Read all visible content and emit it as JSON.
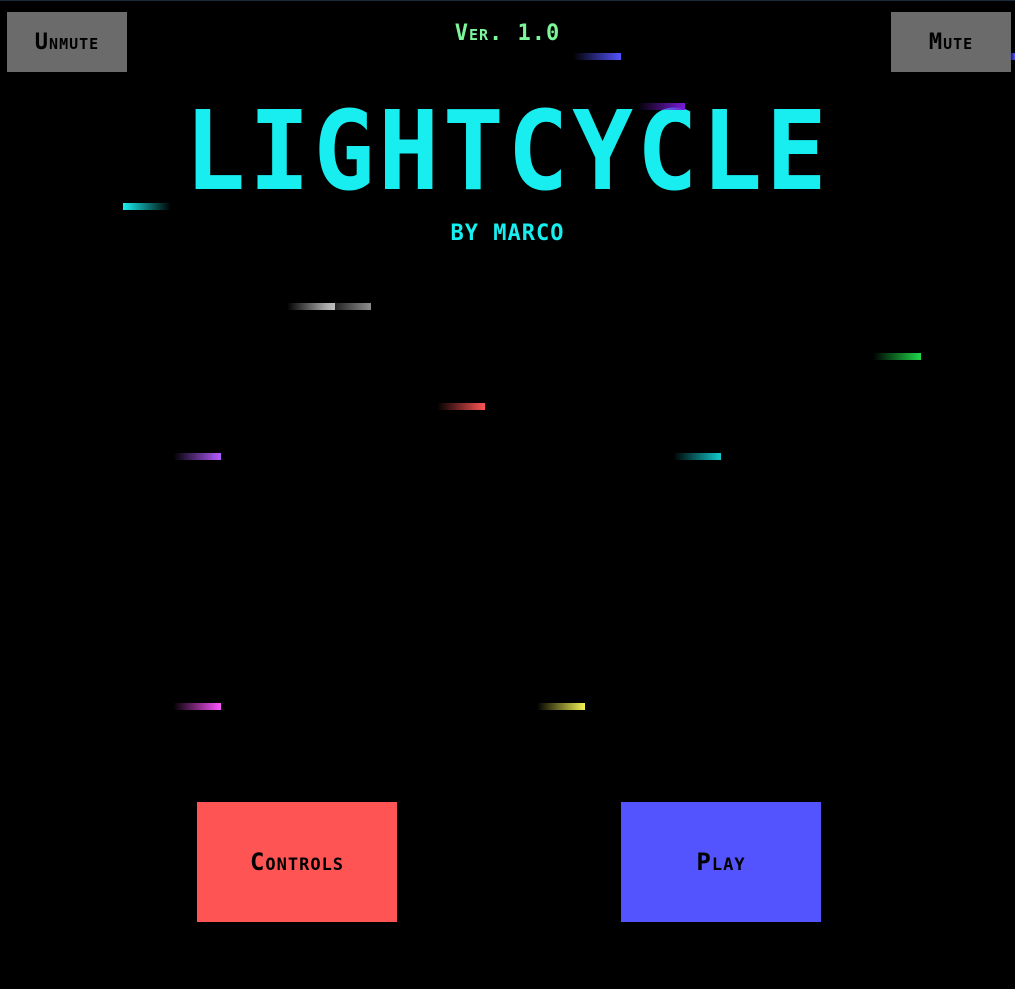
{
  "header": {
    "unmute_label": "Unmute",
    "mute_label": "Mute",
    "version": "Ver. 1.0"
  },
  "title": {
    "game_name": "LIGHTCYCLE",
    "byline": "BY MARCO"
  },
  "menu": {
    "controls_label": "Controls",
    "play_label": "Play"
  },
  "colors": {
    "background": "#000000",
    "title": "#18eef0",
    "version": "#7df59a",
    "top_button": "#6b6b6b",
    "controls_button": "#ff5454",
    "play_button": "#5454ff"
  },
  "trails": [
    {
      "color": "#5454ff",
      "direction": "right"
    },
    {
      "color": "#7a1bd8",
      "direction": "right"
    },
    {
      "color": "#18eef0",
      "direction": "left"
    },
    {
      "color": "#cfcfcf",
      "direction": "right"
    },
    {
      "color": "#8f8f8f",
      "direction": "right"
    },
    {
      "color": "#1fd84a",
      "direction": "right"
    },
    {
      "color": "#ff5454",
      "direction": "right"
    },
    {
      "color": "#b45cff",
      "direction": "right"
    },
    {
      "color": "#12c8cc",
      "direction": "right"
    },
    {
      "color": "#ff54ff",
      "direction": "right"
    },
    {
      "color": "#f2f254",
      "direction": "right"
    },
    {
      "color": "#5454ff",
      "direction": "right"
    }
  ]
}
